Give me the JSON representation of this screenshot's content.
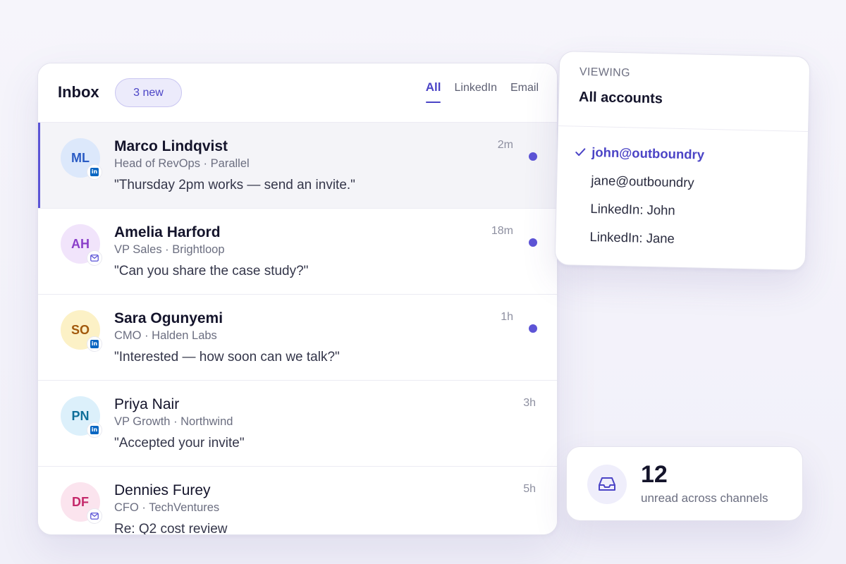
{
  "inbox": {
    "title": "Inbox",
    "new_badge": "3 new",
    "tabs": [
      {
        "label": "All",
        "active": true
      },
      {
        "label": "LinkedIn",
        "active": false
      },
      {
        "label": "Email",
        "active": false
      }
    ],
    "conversations": [
      {
        "initials": "ML",
        "name": "Marco Lindqvist",
        "role": "Head of RevOps · Parallel",
        "preview": "\"Thursday 2pm works — send an invite.\"",
        "time": "2m",
        "unread": true,
        "selected": true,
        "channel": "linkedin",
        "avatar_bg": "#dce8fb",
        "avatar_fg": "#2a5bc4"
      },
      {
        "initials": "AH",
        "name": "Amelia Harford",
        "role": "VP Sales · Brightloop",
        "preview": "\"Can you share the case study?\"",
        "time": "18m",
        "unread": true,
        "selected": false,
        "channel": "email",
        "avatar_bg": "#f1e4fb",
        "avatar_fg": "#8a3fc9"
      },
      {
        "initials": "SO",
        "name": "Sara Ogunyemi",
        "role": "CMO · Halden Labs",
        "preview": "\"Interested — how soon can we talk?\"",
        "time": "1h",
        "unread": true,
        "selected": false,
        "channel": "linkedin",
        "avatar_bg": "#fcf1c6",
        "avatar_fg": "#a2590d"
      },
      {
        "initials": "PN",
        "name": "Priya Nair",
        "role": "VP Growth · Northwind",
        "preview": "\"Accepted your invite\"",
        "time": "3h",
        "unread": false,
        "selected": false,
        "channel": "linkedin",
        "avatar_bg": "#dcf0fb",
        "avatar_fg": "#0f6f99"
      },
      {
        "initials": "DF",
        "name": "Dennies Furey",
        "role": "CFO · TechVentures",
        "preview": "Re: Q2 cost review",
        "time": "5h",
        "unread": false,
        "selected": false,
        "channel": "email",
        "avatar_bg": "#fbe4ee",
        "avatar_fg": "#c4286a"
      }
    ]
  },
  "account_switcher": {
    "label": "VIEWING",
    "current": "All accounts",
    "accounts": [
      {
        "label": "john@outboundry",
        "active": true
      },
      {
        "label": "jane@outboundry",
        "active": false
      },
      {
        "label": "LinkedIn: John",
        "active": false
      },
      {
        "label": "LinkedIn: Jane",
        "active": false
      }
    ]
  },
  "unread_stat": {
    "count": "12",
    "caption": "unread across channels"
  },
  "icons": {
    "linkedin_badge": "linkedin-icon",
    "email_badge": "mail-icon",
    "check": "check-icon",
    "inbox_tray": "inbox-tray-icon"
  },
  "colors": {
    "accent": "#4b44c6",
    "unread_dot": "#5d54d6",
    "linkedin": "#0a66c2",
    "mail": "#5b54d6"
  }
}
